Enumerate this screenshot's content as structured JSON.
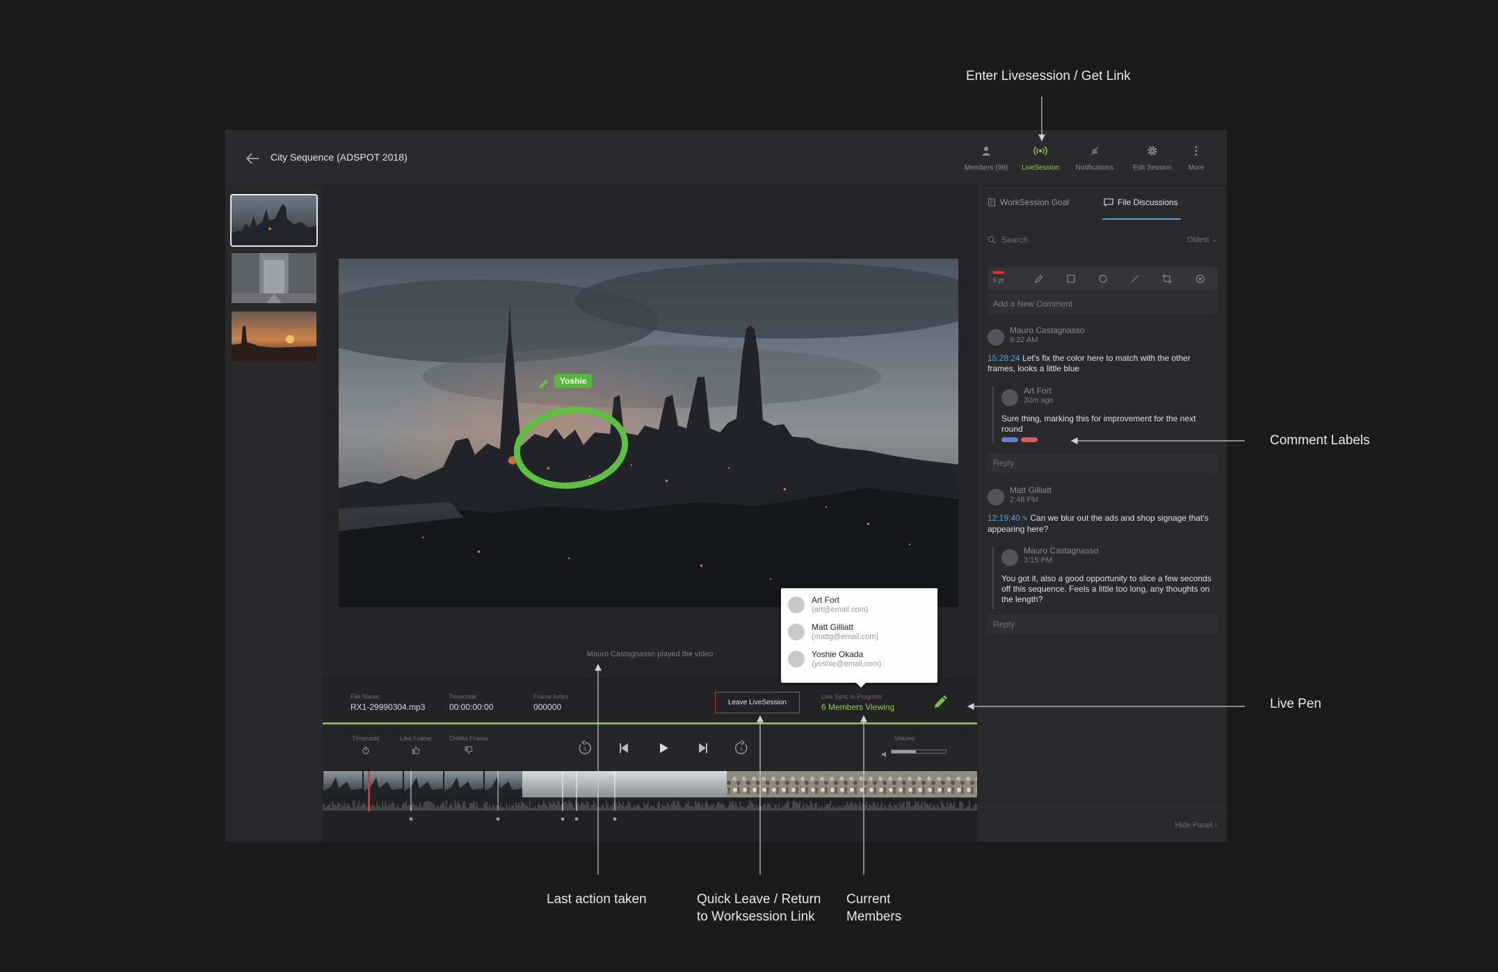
{
  "annotations": {
    "enter_livesession": "Enter Livesession / Get Link",
    "comment_labels": "Comment Labels",
    "live_pen": "Live Pen",
    "last_action": "Last action taken",
    "quick_leave_line1": "Quick Leave / Return",
    "quick_leave_line2": "to Worksession Link",
    "current_members_line1": "Current",
    "current_members_line2": "Members"
  },
  "header": {
    "title": "City Sequence (ADSPOT 2018)",
    "items": [
      {
        "label": "Members (99)",
        "icon": "person-icon"
      },
      {
        "label": "LiveSession",
        "icon": "broadcast-icon"
      },
      {
        "label": "Notifications",
        "icon": "bell-muted-icon"
      },
      {
        "label": "Edit Session",
        "icon": "gear-icon"
      },
      {
        "label": "More",
        "icon": "more-vertical-icon"
      }
    ]
  },
  "viewer": {
    "live_pen_user": "Yoshie",
    "last_action": "Mauro Castagnasso played the video"
  },
  "info": {
    "file_name_label": "File Name",
    "file_name": "RX1-29990304.mp3",
    "timecode_label": "Timecode",
    "timecode": "00:00:00:00",
    "frame_index_label": "Frame Index",
    "frame_index": "000000",
    "leave_button": "Leave LiveSession",
    "sync_label": "Live Sync in Progress",
    "sync_value": "6 Members Viewing"
  },
  "controls": {
    "timecode_label": "Timecode",
    "like_label": "Like Frame",
    "dislike_label": "Dislike Frame",
    "volume_label": "Volume",
    "volume_level": 0.45
  },
  "members_popover": [
    {
      "name": "Art Fort",
      "email": "(art@email.com)"
    },
    {
      "name": "Matt Gilliatt",
      "email": "(mattg@email.com)"
    },
    {
      "name": "Yoshie Okada",
      "email": "(yoshie@email.com)"
    }
  ],
  "panel": {
    "tab_goal": "WorkSession Goal",
    "tab_discussions": "File Discussions",
    "search_placeholder": "Search",
    "sort": "Oldest",
    "stroke_size": "5 pt",
    "new_comment_placeholder": "Add a New Comment",
    "reply_placeholder": "Reply",
    "hide_panel": "Hide Panel",
    "threads": [
      {
        "name": "Mauro Castagnasso",
        "time": "9:32 AM",
        "timecode": "15:28:24",
        "text": "Let's fix the color here to match with the other frames, looks a little blue",
        "reply": {
          "name": "Art Fort",
          "time": "30m ago",
          "text": "Sure thing, marking this for improvement for the next round",
          "labels": [
            "#5a7fd6",
            "#e05a5a"
          ]
        }
      },
      {
        "name": "Matt Gilliatt",
        "time": "2:48 PM",
        "timecode": "12:19:40",
        "text": "Can we blur out the ads and shop signage that's appearing here?",
        "reply": {
          "name": "Mauro Castagnasso",
          "time": "3:15 PM",
          "text": "You got it, also a good opportunity to slice a few seconds off this sequence. Feels a little too long, any thoughts on the length?"
        }
      }
    ]
  },
  "colors": {
    "accent_green": "#8dd148",
    "accent_blue": "#4aa3e0",
    "leave_red": "#c43a3a"
  }
}
